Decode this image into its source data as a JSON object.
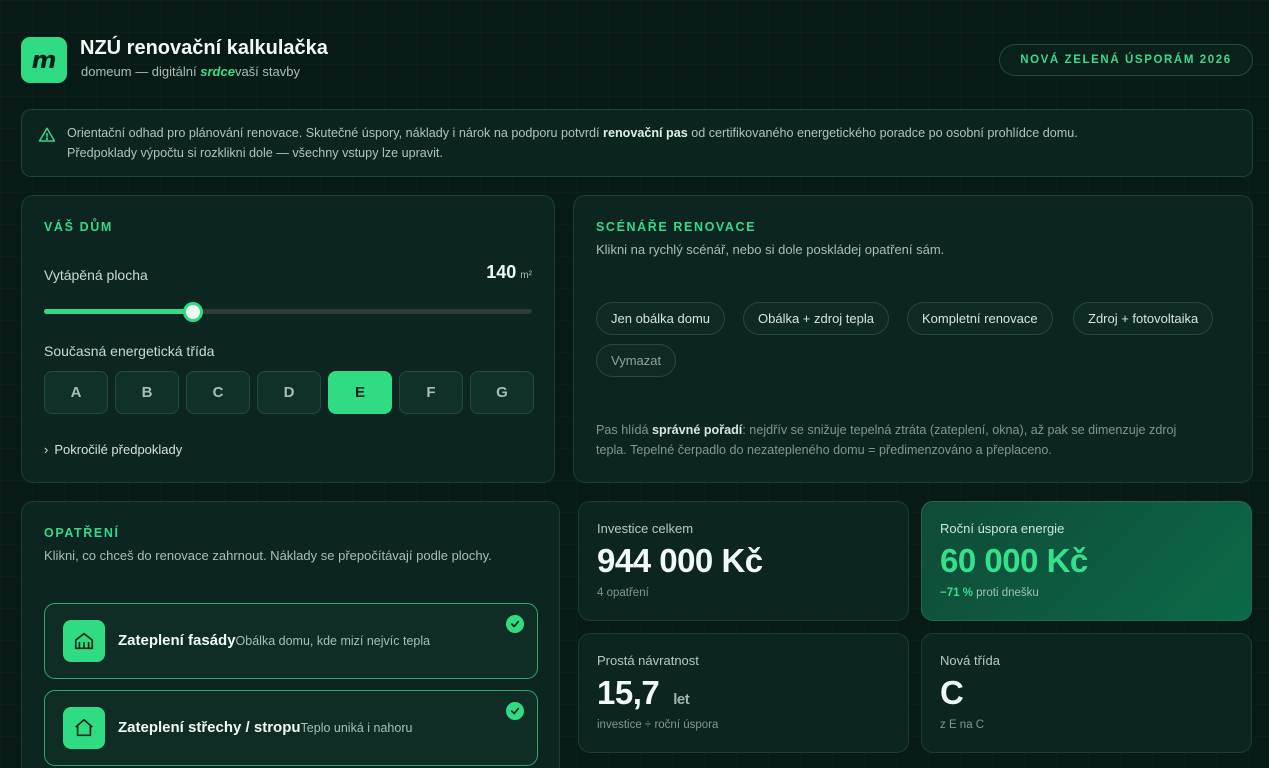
{
  "header": {
    "logo_letter": "m",
    "title": "NZÚ renovační kalkulačka",
    "subtitle_pre": "domeum — digitální ",
    "subtitle_accent": "srdce",
    "subtitle_post": "vaší stavby",
    "badge": "NOVÁ ZELENÁ ÚSPORÁM 2026"
  },
  "banner": {
    "icon": "warning-triangle-icon",
    "text_pre": "Orientační odhad pro plánování renovace. Skutečné úspory, náklady i nárok na podporu potvrdí ",
    "text_bold": "renovační pas",
    "text_post": " od certifikovaného energetického poradce po osobní prohlídce domu.",
    "text_line2": "Předpoklady výpočtu si rozklikni dole — všechny vstupy lze upravit."
  },
  "house": {
    "heading": "VÁŠ DŮM",
    "area_label": "Vytápěná plocha",
    "area_value": "140",
    "area_unit": "m²",
    "area_fraction": 0.306,
    "class_label": "Současná energetická třída",
    "classes": [
      "A",
      "B",
      "C",
      "D",
      "E",
      "F",
      "G"
    ],
    "selected_class": "E",
    "advanced_label": "Pokročilé předpoklady",
    "advanced_icon": "chevron-right-icon"
  },
  "scenarios": {
    "heading": "SCÉNÁŘE RENOVACE",
    "description": "Klikni na rychlý scénář, nebo si dole poskládej opatření sám.",
    "chips": [
      "Jen obálka domu",
      "Obálka + zdroj tepla",
      "Kompletní renovace",
      "Zdroj + fotovoltaika"
    ],
    "clear_label": "Vymazat",
    "hint_pre": "Pas hlídá ",
    "hint_bold": "správné pořadí",
    "hint_post": ": nejdřív se snižuje tepelná ztráta (zateplení, okna), až pak se dimenzuje zdroj",
    "hint_line2": "tepla. Tepelné čerpadlo do nezatepleného domu = předimenzováno a přeplaceno."
  },
  "measures": {
    "heading": "OPATŘENÍ",
    "description": "Klikni, co chceš do renovace zahrnout. Náklady se přepočítávají podle plochy.",
    "items": [
      {
        "title": "Zateplení fasády",
        "subtitle": "Obálka domu, kde mizí nejvíc tepla",
        "icon": "facade-house-icon",
        "checked": true
      },
      {
        "title": "Zateplení střechy / stropu",
        "subtitle": "Teplo uniká i nahoru",
        "icon": "roof-house-icon",
        "checked": true
      }
    ]
  },
  "stats": {
    "investment": {
      "label": "Investice celkem",
      "value": "944 000 Kč",
      "note": "4 opatření"
    },
    "savings": {
      "label": "Roční úspora energie",
      "value": "60 000 Kč",
      "note_accent": "−71 %",
      "note": " proti dnešku"
    },
    "payback": {
      "label": "Prostá návratnost",
      "value": "15,7",
      "unit": "let",
      "note": "investice ÷ roční úspora"
    },
    "new_class": {
      "label": "Nová třída",
      "value": "C",
      "note": "z E na C"
    }
  },
  "colors": {
    "accent": "#2fdc83",
    "background": "#081a15",
    "card": "#0d2520"
  }
}
